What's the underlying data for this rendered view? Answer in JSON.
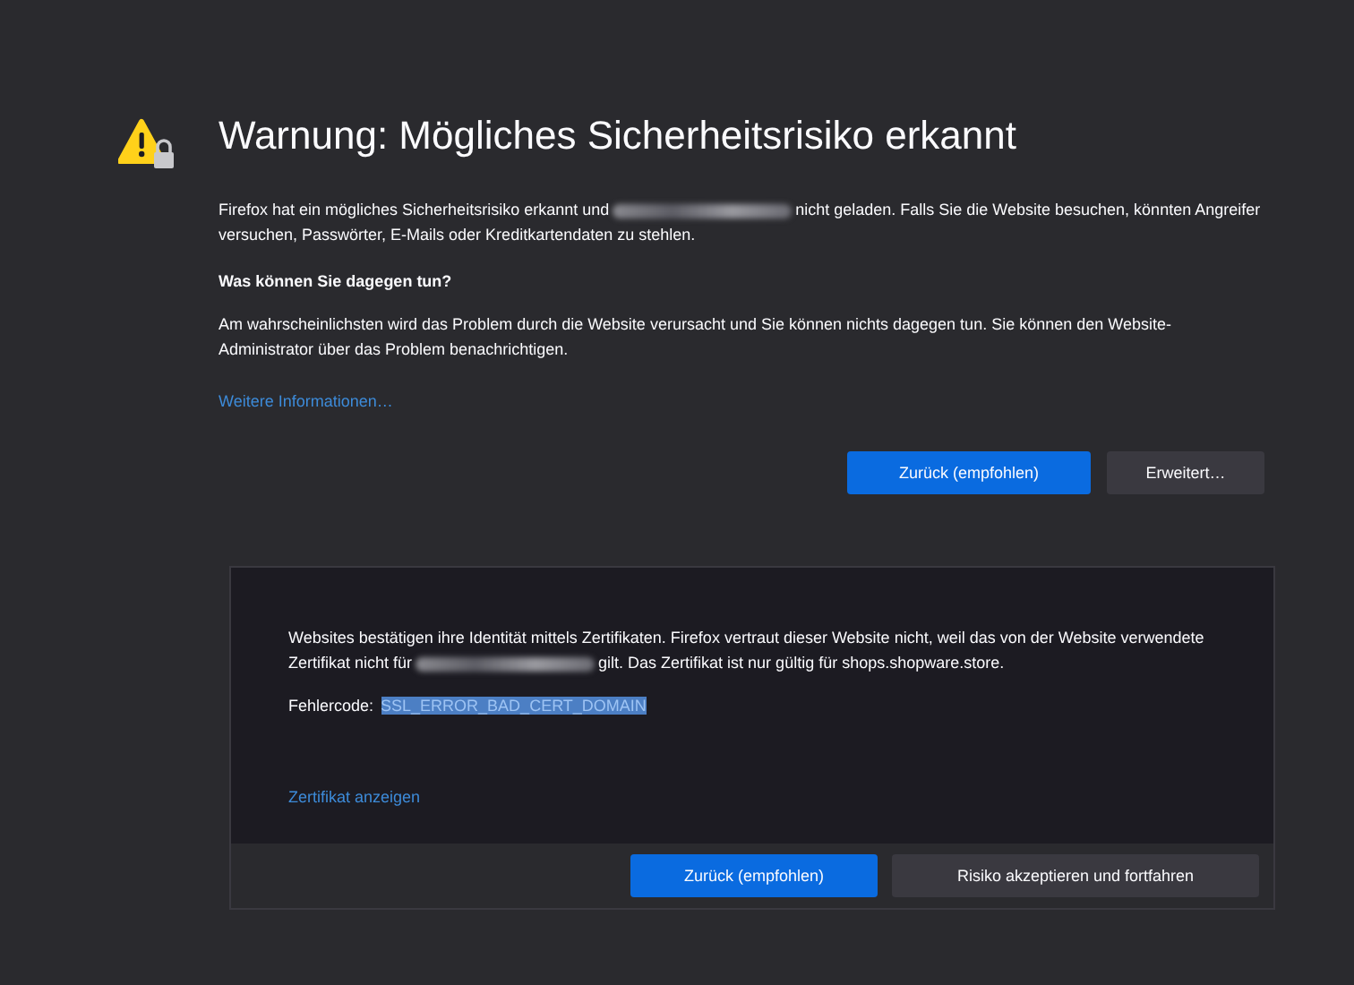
{
  "title": "Warnung: Mögliches Sicherheitsrisiko erkannt",
  "intro": {
    "before": "Firefox hat ein mögliches Sicherheitsrisiko erkannt und",
    "after": "nicht geladen. Falls Sie die Website besuchen, könnten Angreifer versuchen, Passwörter, E-Mails oder Kreditkartendaten zu stehlen."
  },
  "question": "Was können Sie dagegen tun?",
  "answer": "Am wahrscheinlichsten wird das Problem durch die Website verursacht und Sie können nichts dagegen tun. Sie können den Website-Administrator über das Problem benachrichtigen.",
  "more_link": "Weitere Informationen…",
  "buttons": [
    {
      "label": "Zurück (empfohlen)",
      "kind": "primary"
    },
    {
      "label": "Erweitert…",
      "kind": "secondary"
    }
  ],
  "advanced": {
    "text": {
      "before": "Websites bestätigen ihre Identität mittels Zertifikaten. Firefox vertraut dieser Website nicht, weil das von der Website verwendete Zertifikat nicht für",
      "after": "gilt. Das Zertifikat ist nur gültig für shops.shopware.store."
    },
    "error_label": "Fehlercode:",
    "error_code": "SSL_ERROR_BAD_CERT_DOMAIN",
    "error_code_selected": true,
    "cert_link": "Zertifikat anzeigen",
    "buttons": [
      {
        "label": "Zurück (empfohlen)",
        "kind": "primary"
      },
      {
        "label": "Risiko akzeptieren und fortfahren",
        "kind": "secondary"
      }
    ]
  }
}
